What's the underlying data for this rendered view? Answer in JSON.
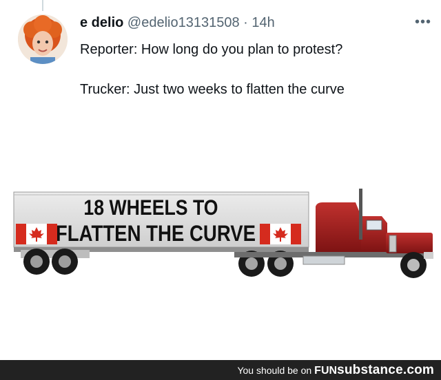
{
  "tweet": {
    "author_name": "e delio",
    "author_handle": "@edelio13131508",
    "separator": "·",
    "time": "14h",
    "more_label": "•••",
    "text_lines": [
      "Reporter: How long do you plan to protest?",
      "Trucker: Just two weeks to flatten the curve"
    ]
  },
  "image": {
    "trailer_text_line1": "18 WHEELS TO",
    "trailer_text_line2": "FLATTEN THE CURVE"
  },
  "footer": {
    "prefix": "You should be on",
    "brand_fun": "FUN",
    "brand_substance": "substance",
    "brand_tld": ".com"
  },
  "colors": {
    "truck_red": "#a51d1d",
    "trailer_gray": "#d9d9d9",
    "flag_red": "#d52b1e"
  }
}
